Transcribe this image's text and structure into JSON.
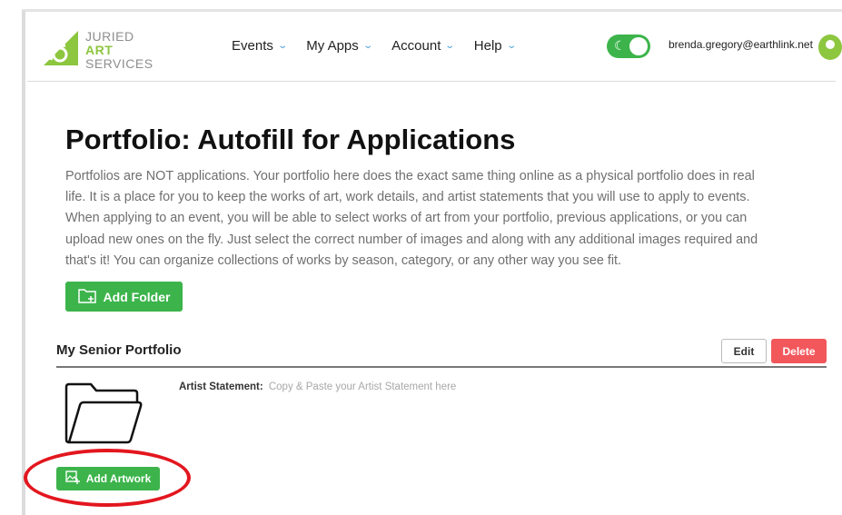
{
  "header": {
    "logo": {
      "line1": "JURIED",
      "line2": "ART",
      "line3": "SERVICES"
    },
    "nav": [
      {
        "label": "Events"
      },
      {
        "label": "My Apps"
      },
      {
        "label": "Account"
      },
      {
        "label": "Help"
      }
    ],
    "theme_toggle": {
      "on": true
    },
    "user_email": "brenda.gregory@earthlink.net"
  },
  "page": {
    "title": "Portfolio: Autofill for Applications",
    "intro": "Portfolios are NOT applications. Your portfolio here does the exact same thing online as a physical portfolio does in real life. It is a place for you to keep the works of art, work details, and artist statements that you will use to apply to events. When applying to an event, you will be able to select works of art from your portfolio, previous applications, or you can upload new ones on the fly. Just select the correct number of images and along with any additional images required and that's it! You can organize collections of works by season, category, or any other way you see fit.",
    "add_folder_label": "Add Folder"
  },
  "folder": {
    "name": "My Senior Portfolio",
    "edit_label": "Edit",
    "delete_label": "Delete",
    "artist_statement_label": "Artist Statement:",
    "artist_statement_placeholder": "Copy & Paste your Artist Statement here",
    "add_artwork_label": "Add Artwork"
  },
  "colors": {
    "accent_green": "#3cb44b",
    "logo_green": "#8dc63f",
    "delete_red": "#f2575c",
    "highlight_red": "#e3161e",
    "chevron_blue": "#4a9fd8"
  },
  "icons": [
    "logo-mark-icon",
    "chevron-down-icon",
    "moon-icon",
    "avatar-icon",
    "folder-plus-icon",
    "folder-open-icon",
    "image-plus-icon"
  ]
}
